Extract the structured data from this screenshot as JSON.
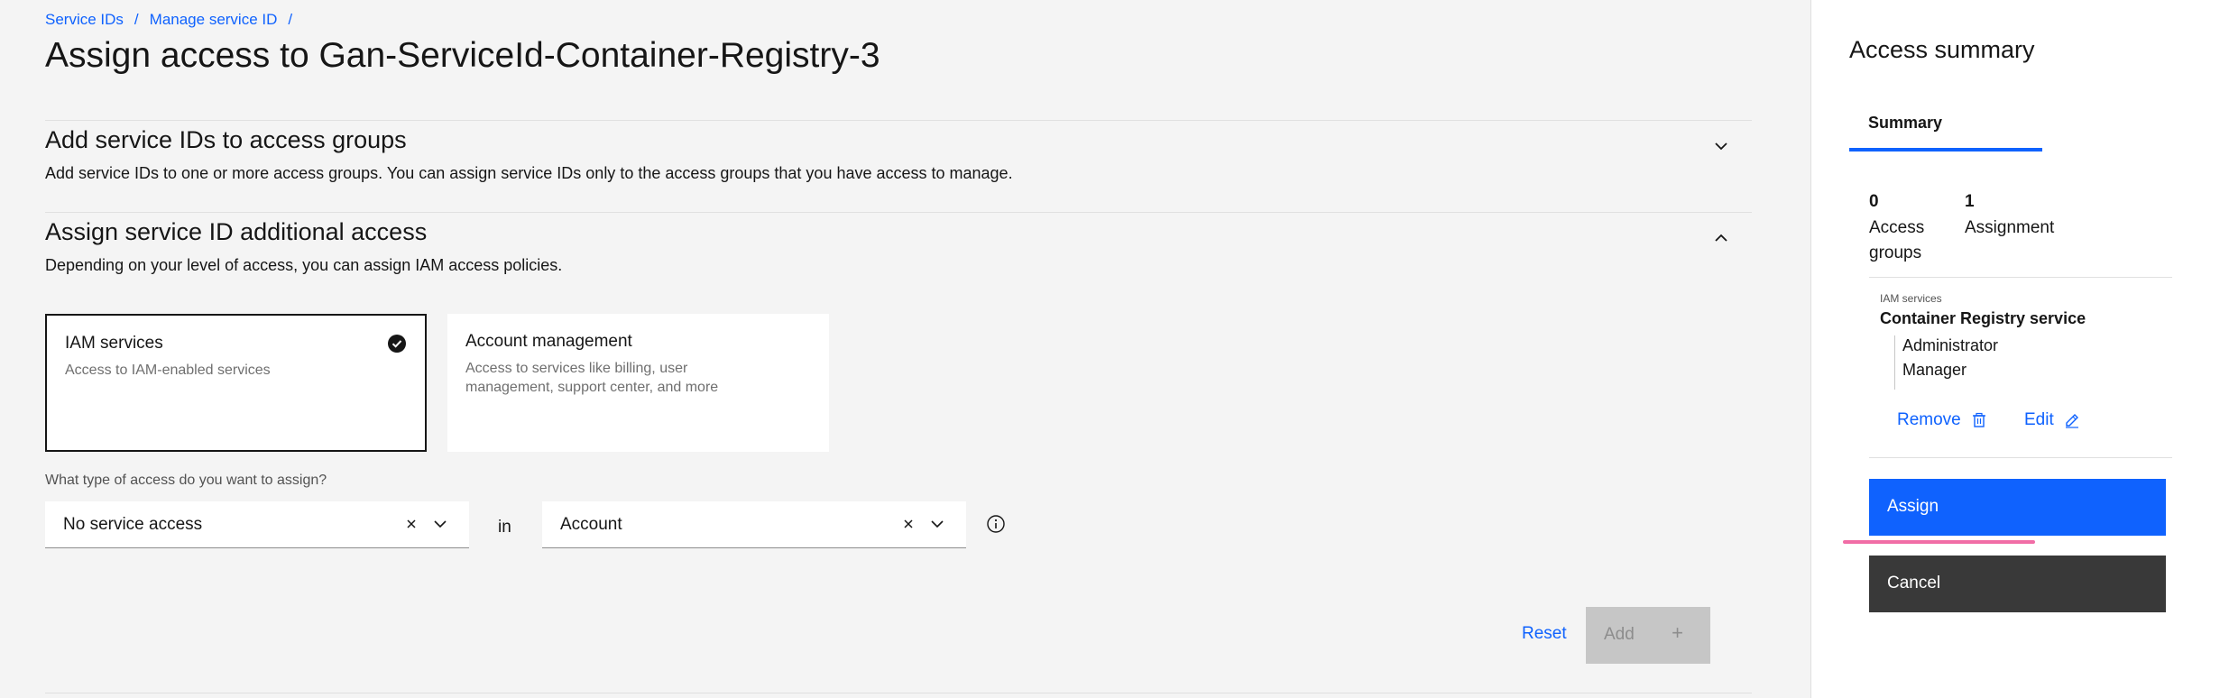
{
  "breadcrumb": {
    "items": [
      "Service IDs",
      "Manage service ID"
    ],
    "separator": "/"
  },
  "page": {
    "title": "Assign access to Gan-ServiceId-Container-Registry-3"
  },
  "section_groups": {
    "title": "Add service IDs to access groups",
    "description": "Add service IDs to one or more access groups. You can assign service IDs only to the access groups that you have access to manage.",
    "expanded": false
  },
  "section_access": {
    "title": "Assign service ID additional access",
    "description": "Depending on your level of access, you can assign IAM access policies.",
    "expanded": true
  },
  "tiles": [
    {
      "title": "IAM services",
      "description": "Access to IAM-enabled services",
      "selected": true
    },
    {
      "title": "Account management",
      "description": "Access to services like billing, user management, support center, and more",
      "selected": false
    }
  ],
  "access_form": {
    "label": "What type of access do you want to assign?",
    "type_select": {
      "value": "No service access"
    },
    "connector": "in",
    "scope_select": {
      "value": "Account"
    }
  },
  "actions": {
    "reset": "Reset",
    "add": "Add",
    "add_icon": "+"
  },
  "summary": {
    "title": "Access summary",
    "tab": "Summary",
    "stats": [
      {
        "value": "0",
        "label_line1": "Access",
        "label_line2": "groups"
      },
      {
        "value": "1",
        "label_line1": "Assignment",
        "label_line2": ""
      }
    ],
    "service_category": "IAM services",
    "service_name": "Container Registry service",
    "roles": [
      "Administrator",
      "Manager"
    ],
    "remove_label": "Remove",
    "edit_label": "Edit",
    "assign_label": "Assign",
    "cancel_label": "Cancel"
  },
  "colors": {
    "accent": "#0f62fe",
    "highlight": "#ee5396",
    "dark_button": "#393939",
    "disabled": "#c6c6c6"
  }
}
